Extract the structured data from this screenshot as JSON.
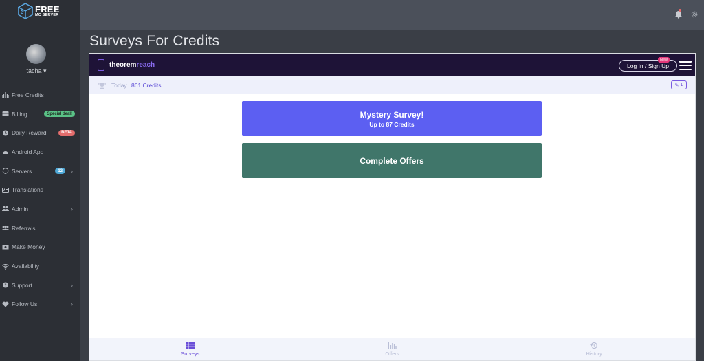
{
  "logo": {
    "line1": "FREE",
    "line2": "MC SERVER"
  },
  "user": {
    "name": "tacha"
  },
  "sidebar": {
    "items": [
      {
        "label": "Free Credits",
        "icon": "free-credits-icon"
      },
      {
        "label": "Billing",
        "icon": "billing-icon",
        "badge": "Special deal!"
      },
      {
        "label": "Daily Reward",
        "icon": "daily-reward-icon",
        "badge": "BETA"
      },
      {
        "label": "Android App",
        "icon": "android-icon"
      },
      {
        "label": "Servers",
        "icon": "servers-icon",
        "badge": "12",
        "chevron": "›"
      },
      {
        "label": "Translations",
        "icon": "translations-icon"
      },
      {
        "label": "Admin",
        "icon": "admin-icon",
        "chevron": "›"
      },
      {
        "label": "Referrals",
        "icon": "referrals-icon"
      },
      {
        "label": "Make Money",
        "icon": "make-money-icon"
      },
      {
        "label": "Availability",
        "icon": "availability-icon"
      },
      {
        "label": "Support",
        "icon": "support-icon",
        "chevron": "›"
      },
      {
        "label": "Follow Us!",
        "icon": "heart-icon",
        "chevron": "›"
      }
    ]
  },
  "page": {
    "title": "Surveys For Credits"
  },
  "theoremreach": {
    "brand_a": "theorem",
    "brand_b": "reach",
    "login_label": "Log In / Sign Up",
    "new_badge": "New",
    "today_label": "Today",
    "credits": "861 Credits",
    "pill": "1",
    "mystery_title": "Mystery Survey!",
    "mystery_sub": "Up to 87 Credits",
    "offers_label": "Complete Offers",
    "tabs": [
      "Surveys",
      "Offers",
      "History"
    ]
  },
  "colors": {
    "brand_purple": "#5c5ff2",
    "offers_green": "#40766a",
    "header_dark": "#1e1337"
  }
}
